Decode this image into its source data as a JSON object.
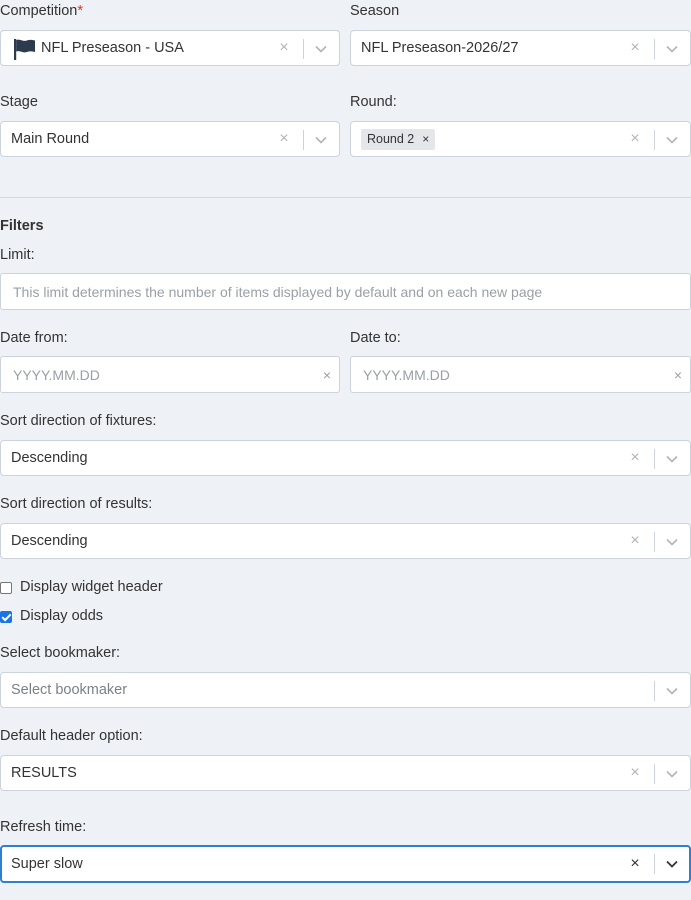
{
  "competition": {
    "label": "Competition",
    "required_mark": "*",
    "value": "NFL Preseason - USA",
    "icon": "flag-icon"
  },
  "season": {
    "label": "Season",
    "value": "NFL Preseason-2026/27"
  },
  "stage": {
    "label": "Stage",
    "value": "Main Round"
  },
  "round": {
    "label": "Round:",
    "chip": "Round 2",
    "chip_remove": "×"
  },
  "filters": {
    "title": "Filters",
    "limit": {
      "label": "Limit:",
      "placeholder": "This limit determines the number of items displayed by default and on each new page"
    },
    "date_from": {
      "label": "Date from:",
      "placeholder": "YYYY.MM.DD"
    },
    "date_to": {
      "label": "Date to:",
      "placeholder": "YYYY.MM.DD"
    },
    "sort_fixtures": {
      "label": "Sort direction of fixtures:",
      "value": "Descending"
    },
    "sort_results": {
      "label": "Sort direction of results:",
      "value": "Descending"
    },
    "display_header": {
      "label": "Display widget header",
      "checked": false
    },
    "display_odds": {
      "label": "Display odds",
      "checked": true
    },
    "bookmaker": {
      "label": "Select bookmaker:",
      "placeholder": "Select bookmaker"
    },
    "default_header": {
      "label": "Default header option:",
      "value": "RESULTS"
    },
    "refresh": {
      "label": "Refresh time:",
      "value": "Super slow"
    }
  },
  "glyphs": {
    "clear": "×"
  },
  "colors": {
    "focus_border": "#2d7fd1",
    "required": "#e0301e",
    "checkbox_checked": "#1a73e8",
    "page_bg": "#eef1f5"
  }
}
